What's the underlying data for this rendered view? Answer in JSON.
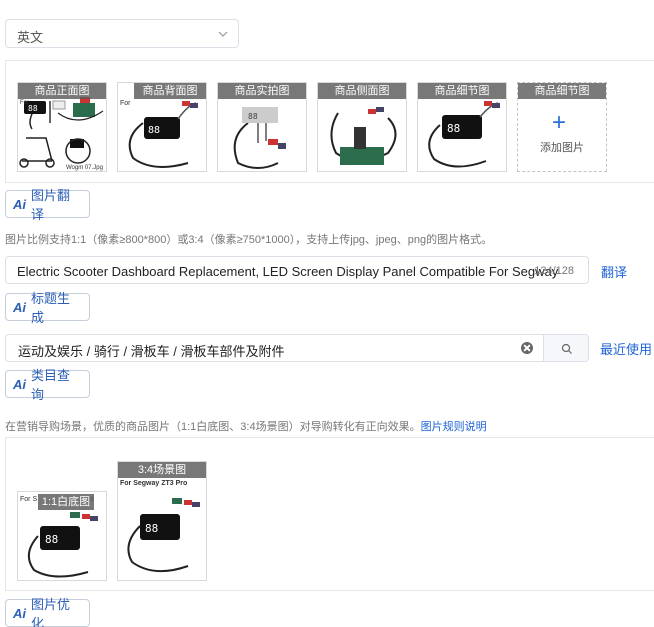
{
  "language": {
    "selected": "英文"
  },
  "main_images": [
    {
      "label": "商品正面图",
      "tiny": "For",
      "filename": "Wogm 07.Jpg"
    },
    {
      "label": "商品背面图",
      "tiny": "For"
    },
    {
      "label": "商品实拍图"
    },
    {
      "label": "商品侧面图"
    },
    {
      "label": "商品细节图"
    }
  ],
  "add_tile": {
    "label": "商品细节图",
    "plus": "+",
    "caption": "添加图片"
  },
  "ai_buttons": {
    "ai": "Ai",
    "translate": "图片翻译",
    "title_gen": "标题生成",
    "category": "类目查询",
    "optimize": "图片优化"
  },
  "image_hint": "图片比例支持1:1（像素≥800*800）或3:4（像素≥750*1000），支持上传jpg、jpeg、png的图片格式。",
  "title_field": {
    "value": "Electric Scooter Dashboard Replacement, LED Screen Display Panel Compatible For Segway",
    "count": "124/128",
    "translate_link": "翻译"
  },
  "category_field": {
    "value": "运动及娱乐 / 骑行 / 滑板车 / 滑板车部件及附件",
    "recent_link": "最近使用"
  },
  "marketing_hint": {
    "text": "在营销导购场景，优质的商品图片（1:1白底图、3:4场景图）对导购转化有正向效果。",
    "link": "图片规则说明"
  },
  "marketing_images": [
    {
      "label": "1:1白底图",
      "tiny": "For S",
      "tiny2": "o"
    },
    {
      "label": "3:4场景图",
      "caption": "For Segway ZT3 Pro"
    }
  ],
  "colors": {
    "accent": "#2c5fb6",
    "link": "#1e63d6"
  }
}
